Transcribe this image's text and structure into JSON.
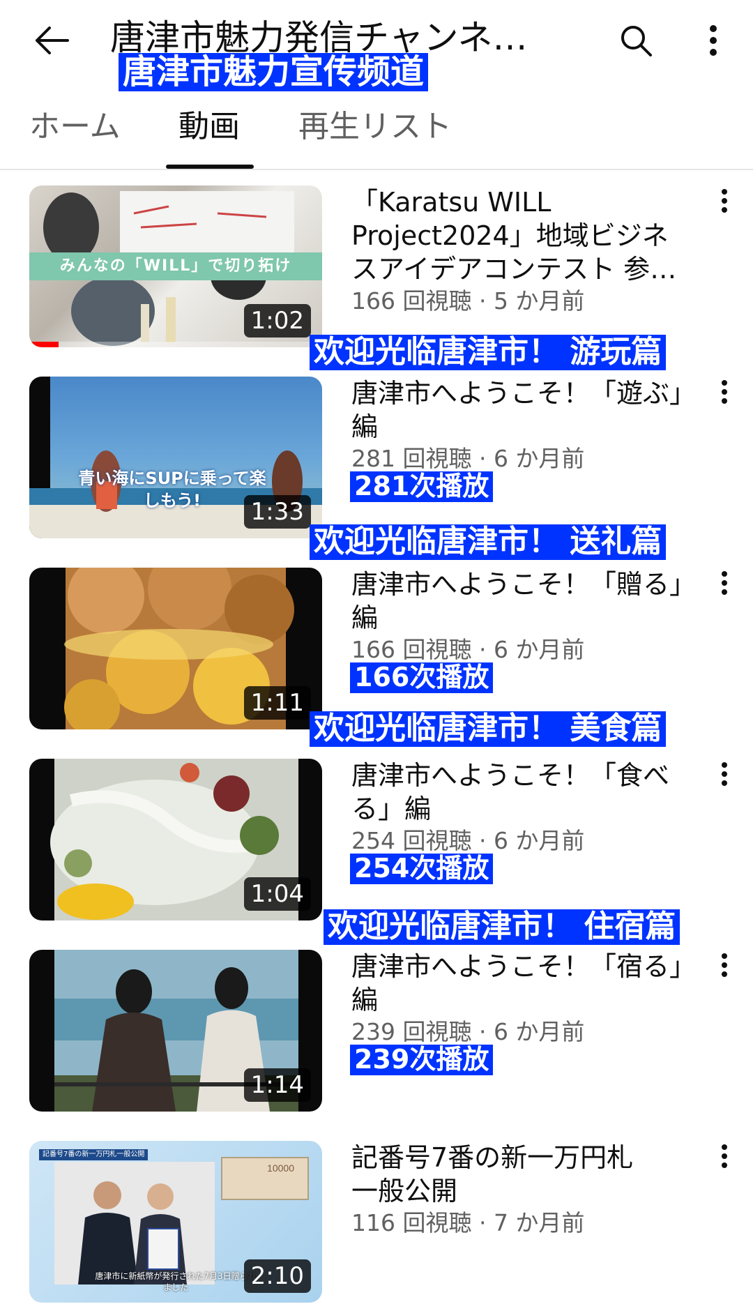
{
  "header": {
    "title": "唐津市魅力発信チャンネル…",
    "title_overlay": "唐津市魅力宣传频道"
  },
  "tabs": [
    {
      "label": "ホーム"
    },
    {
      "label": "動画"
    },
    {
      "label": "再生リスト"
    }
  ],
  "selected_tab": "動画",
  "videos": [
    {
      "title": "「Karatsu WILL Project2024」地域ビジネスアイデアコンテスト 参加…",
      "duration": "1:02",
      "meta": "166 回視聴 · 5 か月前",
      "thumb_text": "みんなの「WILL」で切り拓け",
      "watched_progress": 0.1
    },
    {
      "title": "唐津市へようこそ！「遊ぶ」編",
      "duration": "1:33",
      "meta": "281 回視聴 · 6 か月前",
      "thumb_text": "青い海にSUPに乗って楽しもう!",
      "overlay_head": "欢迎光临唐津市！ 游玩篇",
      "overlay_views": "281次播放"
    },
    {
      "title": "唐津市へようこそ！「贈る」編",
      "duration": "1:11",
      "meta": "166 回視聴 · 6 か月前",
      "overlay_head": "欢迎光临唐津市！ 送礼篇",
      "overlay_views": "166次播放"
    },
    {
      "title": "唐津市へようこそ！「食べる」編",
      "duration": "1:04",
      "meta": "254 回視聴 · 6 か月前",
      "overlay_head": "欢迎光临唐津市！ 美食篇",
      "overlay_views": "254次播放"
    },
    {
      "title": "唐津市へようこそ！「宿る」編",
      "duration": "1:14",
      "meta": "239 回視聴 · 6 か月前",
      "overlay_head": "欢迎光临唐津市！ 住宿篇",
      "overlay_views": "239次播放"
    },
    {
      "title": "記番号7番の新一万円札　一般公開",
      "duration": "2:10",
      "meta": "116 回視聴 · 7 か月前",
      "thumb_caption_top": "記番号7番の新一万円札一般公開",
      "thumb_caption_bottom": "唐津市に新紙幣が発行された7月3日贈られました"
    }
  ],
  "colors": {
    "overlay_bg": "#0033ff",
    "progress_red": "#ff0000",
    "meta_gray": "#606060"
  }
}
